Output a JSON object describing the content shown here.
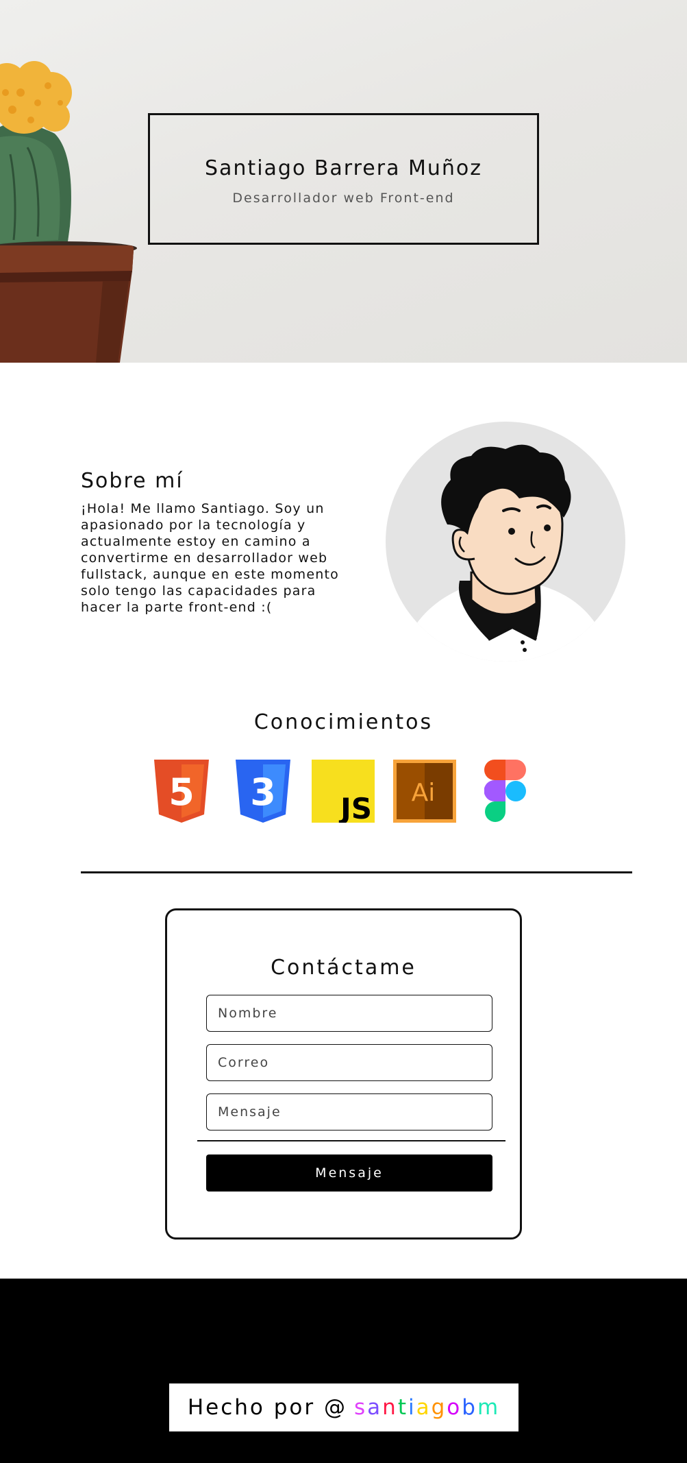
{
  "hero": {
    "name": "Santiago Barrera Muñoz",
    "role": "Desarrollador web Front-end"
  },
  "about": {
    "title": "Sobre mí",
    "text": "¡Hola! Me llamo Santiago. Soy un apasionado por la tecnología y actualmente estoy en camino a convertirme en desarrollador web fullstack, aunque en este momento solo tengo las capacidades para hacer la parte front-end :("
  },
  "skills": {
    "title": "Conocimientos",
    "icons": [
      "html5-icon",
      "css3-icon",
      "javascript-icon",
      "illustrator-icon",
      "figma-icon"
    ],
    "html_label": "5",
    "css_label": "3",
    "js_label": "JS",
    "ai_label": "Ai"
  },
  "contact": {
    "title": "Contáctame",
    "name_placeholder": "Nombre",
    "email_placeholder": "Correo",
    "message_placeholder": "Mensaje",
    "submit_label": "Mensaje"
  },
  "footer": {
    "credit_prefix": "Hecho por @",
    "handle_letters": [
      {
        "char": "s",
        "color": "#e040fb"
      },
      {
        "char": "a",
        "color": "#7c4dff"
      },
      {
        "char": "n",
        "color": "#ff1744"
      },
      {
        "char": "t",
        "color": "#00c853"
      },
      {
        "char": "i",
        "color": "#2979ff"
      },
      {
        "char": "a",
        "color": "#ffd600"
      },
      {
        "char": "g",
        "color": "#ff9100"
      },
      {
        "char": "o",
        "color": "#d500f9"
      },
      {
        "char": "b",
        "color": "#2962ff"
      },
      {
        "char": "m",
        "color": "#1de9b6"
      }
    ]
  },
  "colors": {
    "html_orange": "#e44d26",
    "css_blue": "#2965f1",
    "js_yellow": "#f7df1e",
    "ai_brown": "#9a4e00",
    "ai_orange": "#f7a33a",
    "background_dark": "#000000"
  }
}
